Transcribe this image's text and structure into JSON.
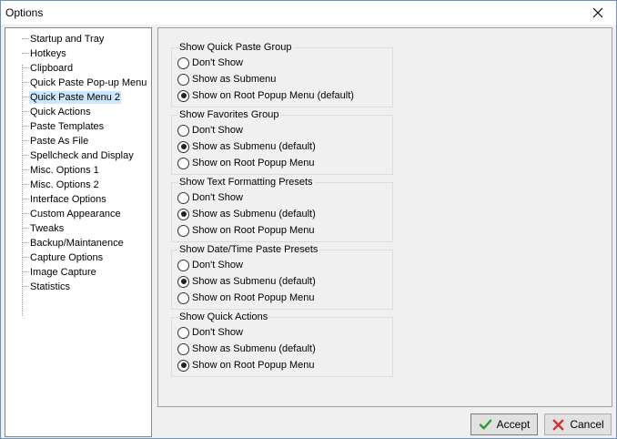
{
  "window": {
    "title": "Options"
  },
  "tree": {
    "items": [
      "Startup and Tray",
      "Hotkeys",
      "Clipboard",
      "Quick Paste Pop-up Menu",
      "Quick Paste Menu 2",
      "Quick Actions",
      "Paste Templates",
      "Paste As File",
      "Spellcheck and Display",
      "Misc. Options 1",
      "Misc. Options 2",
      "Interface Options",
      "Custom Appearance",
      "Tweaks",
      "Backup/Maintanence",
      "Capture Options",
      "Image Capture",
      "Statistics"
    ],
    "selected_index": 4
  },
  "groups": [
    {
      "title": "Show Quick Paste Group",
      "options": [
        "Don't Show",
        "Show as Submenu",
        "Show on Root Popup Menu (default)"
      ],
      "selected": 2
    },
    {
      "title": "Show Favorites Group",
      "options": [
        "Don't Show",
        "Show as Submenu (default)",
        "Show on Root Popup Menu"
      ],
      "selected": 1
    },
    {
      "title": "Show Text Formatting Presets",
      "options": [
        "Don't Show",
        "Show as Submenu (default)",
        "Show on Root Popup Menu"
      ],
      "selected": 1
    },
    {
      "title": "Show Date/Time Paste Presets",
      "options": [
        "Don't Show",
        "Show as Submenu (default)",
        "Show on Root Popup Menu"
      ],
      "selected": 1
    },
    {
      "title": "Show Quick Actions",
      "options": [
        "Don't Show",
        "Show as Submenu (default)",
        "Show on Root Popup Menu"
      ],
      "selected": 2
    }
  ],
  "buttons": {
    "accept": "Accept",
    "cancel": "Cancel"
  },
  "icons": {
    "accept": "checkmark-icon",
    "cancel": "x-icon",
    "close": "close-icon"
  },
  "colors": {
    "accept_icon": "#2e9e2e",
    "cancel_icon": "#d03030",
    "selection": "#cce8ff"
  }
}
